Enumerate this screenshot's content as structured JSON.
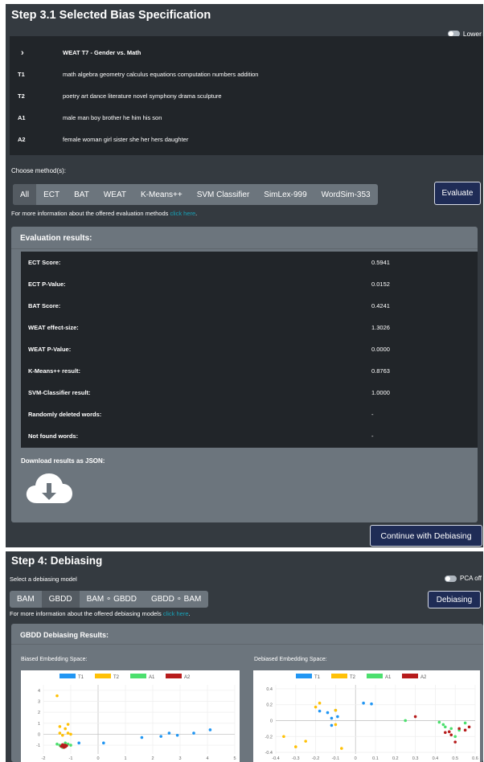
{
  "step31": {
    "title": "Step 3.1 Selected Bias Specification",
    "toggle_label": "Lower",
    "spec": {
      "expander": "›",
      "name": "WEAT T7 - Gender vs. Math",
      "rows": [
        {
          "key": "T1",
          "value": "math algebra geometry calculus equations computation numbers addition"
        },
        {
          "key": "T2",
          "value": "poetry art dance literature novel symphony drama sculpture"
        },
        {
          "key": "A1",
          "value": "male man boy brother he him his son"
        },
        {
          "key": "A2",
          "value": "female woman girl sister she her hers daughter"
        }
      ]
    },
    "choose_label": "Choose method(s):",
    "methods": [
      "All",
      "ECT",
      "BAT",
      "WEAT",
      "K-Means++",
      "SVM Classifier",
      "SimLex-999",
      "WordSim-353"
    ],
    "active_method": "All",
    "evaluate_label": "Evaluate",
    "info_text": "For more information about the offered evaluation methods ",
    "info_link": "click here",
    "info_tail": ".",
    "results_title": "Evaluation results:",
    "results": [
      {
        "key": "ECT Score:",
        "value": "0.5941"
      },
      {
        "key": "ECT P-Value:",
        "value": "0.0152"
      },
      {
        "key": "BAT Score:",
        "value": "0.4241"
      },
      {
        "key": "WEAT effect-size:",
        "value": "1.3026"
      },
      {
        "key": "WEAT P-Value:",
        "value": "0.0000"
      },
      {
        "key": "K-Means++ result:",
        "value": "0.8763"
      },
      {
        "key": "SVM-Classifier result:",
        "value": "1.0000"
      },
      {
        "key": "Randomly deleted words:",
        "value": "-"
      },
      {
        "key": "Not found words:",
        "value": "-"
      }
    ],
    "download_label": "Download results as JSON:",
    "continue_label": "Continue with Debiasing"
  },
  "step4": {
    "title": "Step 4: Debiasing",
    "select_label": "Select a debiasing model",
    "toggle_label": "PCA off",
    "models": [
      "BAM",
      "GBDD",
      "BAM ∘ GBDD",
      "GBDD ∘ BAM"
    ],
    "active_model": "GBDD",
    "debias_label": "Debiasing",
    "info_text": "For more information about the offered debiasing models ",
    "info_link": "click here",
    "info_tail": ".",
    "results_title": "GBDD Debiasing Results:",
    "biased_label": "Biased Embedding Space:",
    "debiased_label": "Debiased Embedding Space:"
  },
  "colors": {
    "T1": "#2196f3",
    "T2": "#ffc107",
    "A1": "#4cdf6e",
    "A2": "#b71c1c"
  },
  "chart_data": [
    {
      "type": "scatter",
      "legend": [
        "T1",
        "T2",
        "A1",
        "A2"
      ],
      "legend_position": "top",
      "grid": true,
      "x_ticks": [
        "-2",
        "-1",
        "0",
        "1",
        "2",
        "3",
        "4",
        "5"
      ],
      "y_ticks": [
        "4",
        "3",
        "2",
        "1",
        "0",
        "-1"
      ],
      "xlim": [
        -2,
        5
      ],
      "ylim": [
        -1.8,
        4.5
      ],
      "series": [
        {
          "name": "T1",
          "points": [
            [
              -0.7,
              -0.8
            ],
            [
              0.2,
              -0.8
            ],
            [
              1.6,
              -0.3
            ],
            [
              2.3,
              -0.2
            ],
            [
              2.6,
              0.1
            ],
            [
              2.9,
              -0.1
            ],
            [
              3.5,
              0.1
            ],
            [
              4.1,
              0.4
            ]
          ]
        },
        {
          "name": "T2",
          "points": [
            [
              -1.5,
              3.5
            ],
            [
              -1.4,
              0.7
            ],
            [
              -1.1,
              0.9
            ],
            [
              -1.3,
              -0.1
            ],
            [
              -1.1,
              0.1
            ],
            [
              -1.0,
              0.0
            ],
            [
              -1.2,
              0.5
            ],
            [
              -1.4,
              0.1
            ]
          ]
        },
        {
          "name": "A1",
          "points": [
            [
              -1.5,
              -0.9
            ],
            [
              -1.3,
              -1.0
            ],
            [
              -1.2,
              -1.1
            ],
            [
              -1.1,
              -0.9
            ],
            [
              -1.3,
              -1.2
            ],
            [
              -1.4,
              -1.0
            ],
            [
              -1.0,
              -1.0
            ],
            [
              -1.2,
              -0.8
            ]
          ]
        },
        {
          "name": "A2",
          "points": [
            [
              -1.3,
              -1.1
            ],
            [
              -1.25,
              -1.0
            ],
            [
              -1.2,
              -1.15
            ],
            [
              -1.3,
              -0.95
            ],
            [
              -1.15,
              -1.05
            ],
            [
              -1.35,
              -1.1
            ],
            [
              -1.25,
              -1.2
            ],
            [
              -1.2,
              -1.0
            ]
          ]
        }
      ]
    },
    {
      "type": "scatter",
      "legend": [
        "T1",
        "T2",
        "A1",
        "A2"
      ],
      "legend_position": "top",
      "grid": true,
      "x_ticks": [
        "-0.4",
        "-0.3",
        "-0.2",
        "-0.1",
        "0",
        "0.1",
        "0.2",
        "0.3",
        "0.4",
        "0.5",
        "0.6"
      ],
      "y_ticks": [
        "0.4",
        "0.2",
        "0",
        "-0.2",
        "-0.4"
      ],
      "xlim": [
        -0.4,
        0.6
      ],
      "ylim": [
        -0.42,
        0.45
      ],
      "series": [
        {
          "name": "T1",
          "points": [
            [
              -0.18,
              0.12
            ],
            [
              -0.14,
              0.1
            ],
            [
              -0.12,
              0.03
            ],
            [
              -0.09,
              0.05
            ],
            [
              -0.1,
              0.13
            ],
            [
              0.04,
              0.22
            ],
            [
              0.08,
              0.21
            ],
            [
              -0.12,
              -0.06
            ]
          ]
        },
        {
          "name": "T2",
          "points": [
            [
              -0.18,
              0.22
            ],
            [
              -0.2,
              0.17
            ],
            [
              -0.1,
              0.13
            ],
            [
              -0.25,
              -0.26
            ],
            [
              -0.36,
              -0.2
            ],
            [
              -0.3,
              -0.33
            ],
            [
              -0.07,
              -0.35
            ],
            [
              -0.1,
              -0.05
            ]
          ]
        },
        {
          "name": "A1",
          "points": [
            [
              0.25,
              0.0
            ],
            [
              0.44,
              -0.05
            ],
            [
              0.48,
              -0.1
            ],
            [
              0.5,
              -0.2
            ],
            [
              0.52,
              -0.12
            ],
            [
              0.55,
              -0.03
            ],
            [
              0.45,
              -0.08
            ],
            [
              0.42,
              -0.02
            ]
          ]
        },
        {
          "name": "A2",
          "points": [
            [
              0.3,
              0.05
            ],
            [
              0.45,
              -0.15
            ],
            [
              0.48,
              -0.18
            ],
            [
              0.52,
              -0.1
            ],
            [
              0.55,
              -0.12
            ],
            [
              0.5,
              -0.27
            ],
            [
              0.47,
              -0.14
            ],
            [
              0.57,
              -0.08
            ]
          ]
        }
      ]
    }
  ]
}
